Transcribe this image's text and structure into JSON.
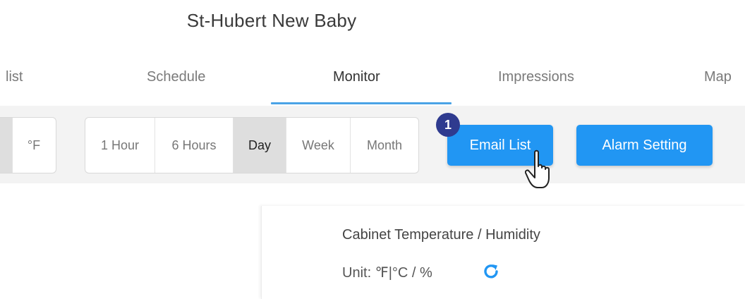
{
  "header": {
    "title": "St-Hubert New Baby"
  },
  "tabs": [
    {
      "label": "list"
    },
    {
      "label": "Schedule"
    },
    {
      "label": "Monitor",
      "active": true
    },
    {
      "label": "Impressions"
    },
    {
      "label": "Map"
    }
  ],
  "toolbar": {
    "unit_options": [
      "°F"
    ],
    "range_options": [
      "1 Hour",
      "6 Hours",
      "Day",
      "Week",
      "Month"
    ],
    "selected_range": "Day",
    "email_list_label": "Email List",
    "email_list_badge": "1",
    "alarm_setting_label": "Alarm Setting"
  },
  "card": {
    "title": "Cabinet Temperature / Humidity",
    "unit_text": "Unit:   ℉|°C / %"
  },
  "colors": {
    "primary": "#2196f3",
    "badge": "#2f3b8f",
    "tab_underline": "#4aa3e6",
    "toolbar_bg": "#f3f3f3"
  },
  "icons": [
    "refresh-icon",
    "pointer-cursor-icon"
  ]
}
